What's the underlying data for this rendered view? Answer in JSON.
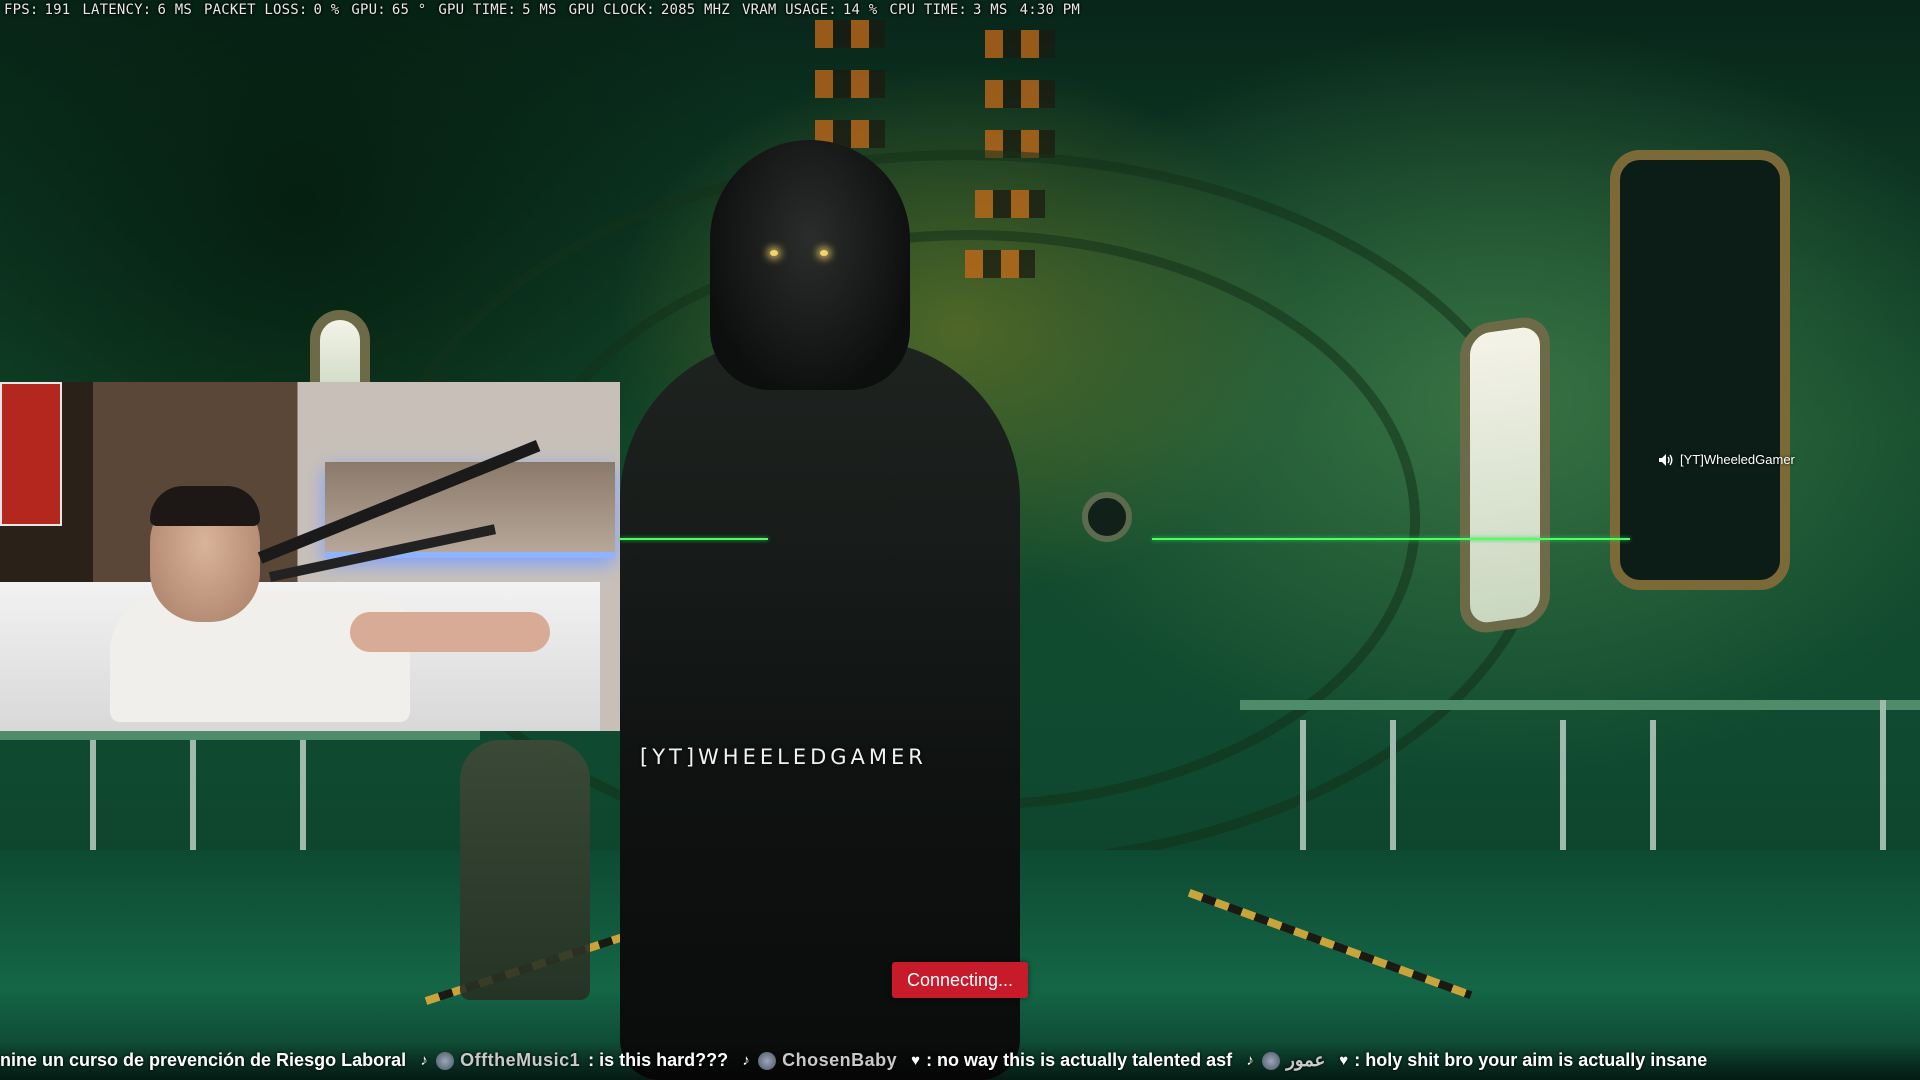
{
  "perf_stats": [
    {
      "label": "FPS:",
      "value": "191"
    },
    {
      "label": "LATENCY:",
      "value": "6 MS"
    },
    {
      "label": "PACKET LOSS:",
      "value": "0 %"
    },
    {
      "label": "GPU:",
      "value": "65 °"
    },
    {
      "label": "GPU TIME:",
      "value": "5 MS"
    },
    {
      "label": "GPU CLOCK:",
      "value": "2085 MHZ"
    },
    {
      "label": "VRAM USAGE:",
      "value": "14 %"
    },
    {
      "label": "CPU TIME:",
      "value": "3 MS"
    },
    {
      "label": "",
      "value": "4:30 PM"
    }
  ],
  "speaker_tag": {
    "icon": "speaker-icon",
    "name": "[YT]WheeledGamer"
  },
  "player_nameplate": "[YT]WHEELEDGAMER",
  "status_button": {
    "label": "Connecting...",
    "color": "#c71a2a"
  },
  "chat_ticker": {
    "lead_text": "nine un curso de prevención de Riesgo Laboral",
    "messages": [
      {
        "platform_icon": "tiktok-icon",
        "user": "OfftheMusic1",
        "text": ": is this hard???"
      },
      {
        "platform_icon": "tiktok-icon",
        "user": "ChosenBaby",
        "text": ": no way this is actually talented asf"
      },
      {
        "platform_icon": "tiktok-icon",
        "user": "عمور",
        "text": ": holy shit bro your aim is actually insane"
      }
    ]
  },
  "colors": {
    "hud_green": "#4cff66",
    "alert_red": "#c71a2a"
  }
}
